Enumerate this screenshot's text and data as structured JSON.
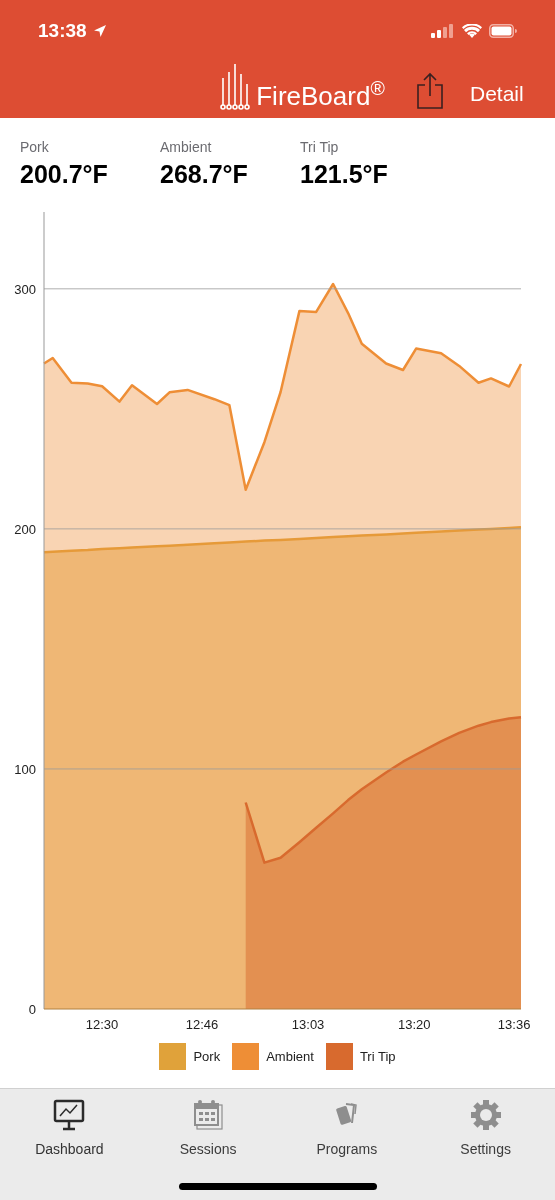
{
  "status_bar": {
    "time": "13:38"
  },
  "nav": {
    "logo": "FireBoard$^{®}$",
    "detail": "Detail"
  },
  "readings": [
    {
      "label": "Pork",
      "value": "200.7°F"
    },
    {
      "label": "Ambient",
      "value": "268.7°F"
    },
    {
      "label": "Tri Tip",
      "value": "121.5°F"
    }
  ],
  "chart": {
    "chart_data": {
      "type": "area",
      "x": [
        740.7,
        742.1,
        745.1,
        747.7,
        750,
        752.8,
        754.8,
        758.8,
        760.8,
        763.7,
        768,
        770.4,
        773,
        776,
        778.6,
        781.6,
        784.3,
        787,
        789.4,
        791.6,
        795.5,
        798.2,
        800.3,
        804.3,
        807.2,
        810.3,
        812.3,
        815.2,
        817.1
      ],
      "series": [
        {
          "name": "Pork",
          "color": "#e0a23a",
          "values": [
            190.3,
            190.5,
            190.9,
            191.2,
            191.6,
            191.9,
            192.2,
            192.8,
            193,
            193.4,
            194,
            194.3,
            194.7,
            195.1,
            195.4,
            195.8,
            196.2,
            196.6,
            196.9,
            197.2,
            197.7,
            198.1,
            198.4,
            198.9,
            199.3,
            199.7,
            200,
            200.4,
            200.7
          ]
        },
        {
          "name": "Ambient",
          "color": "#ee8e36",
          "values": [
            268.9,
            271.2,
            260.9,
            260.5,
            259.4,
            253,
            259.8,
            252,
            256.9,
            257.9,
            254,
            251.5,
            216.3,
            236.1,
            257,
            290.7,
            290.4,
            302,
            289.9,
            277.1,
            268.9,
            266.2,
            275.1,
            273.2,
            267.9,
            260.9,
            262.7,
            259.3,
            268.7
          ]
        },
        {
          "name": "Tri Tip",
          "color": "#d86a2e",
          "values": [
            null,
            null,
            null,
            null,
            null,
            null,
            null,
            null,
            null,
            null,
            null,
            null,
            86,
            61,
            63,
            69.5,
            75.5,
            81.5,
            87,
            91.5,
            98.5,
            103,
            106,
            111.5,
            115,
            118,
            119.5,
            121,
            121.5
          ]
        }
      ],
      "xlim": [
        740.7,
        817.1
      ],
      "ylim": [
        0,
        332
      ],
      "xticks": [
        {
          "value": 750,
          "label": "12:30"
        },
        {
          "value": 766,
          "label": "12:46"
        },
        {
          "value": 783,
          "label": "13:03"
        },
        {
          "value": 800,
          "label": "13:20"
        },
        {
          "value": 816,
          "label": "13:36"
        }
      ],
      "yticks": [
        0,
        100,
        200,
        300
      ],
      "grid": true
    }
  },
  "tabs": [
    {
      "label": "Dashboard",
      "kind": "dashboard",
      "selected": true
    },
    {
      "label": "Sessions",
      "kind": "sessions",
      "selected": false
    },
    {
      "label": "Programs",
      "kind": "programs",
      "selected": false
    },
    {
      "label": "Settings",
      "kind": "settings",
      "selected": false
    }
  ]
}
